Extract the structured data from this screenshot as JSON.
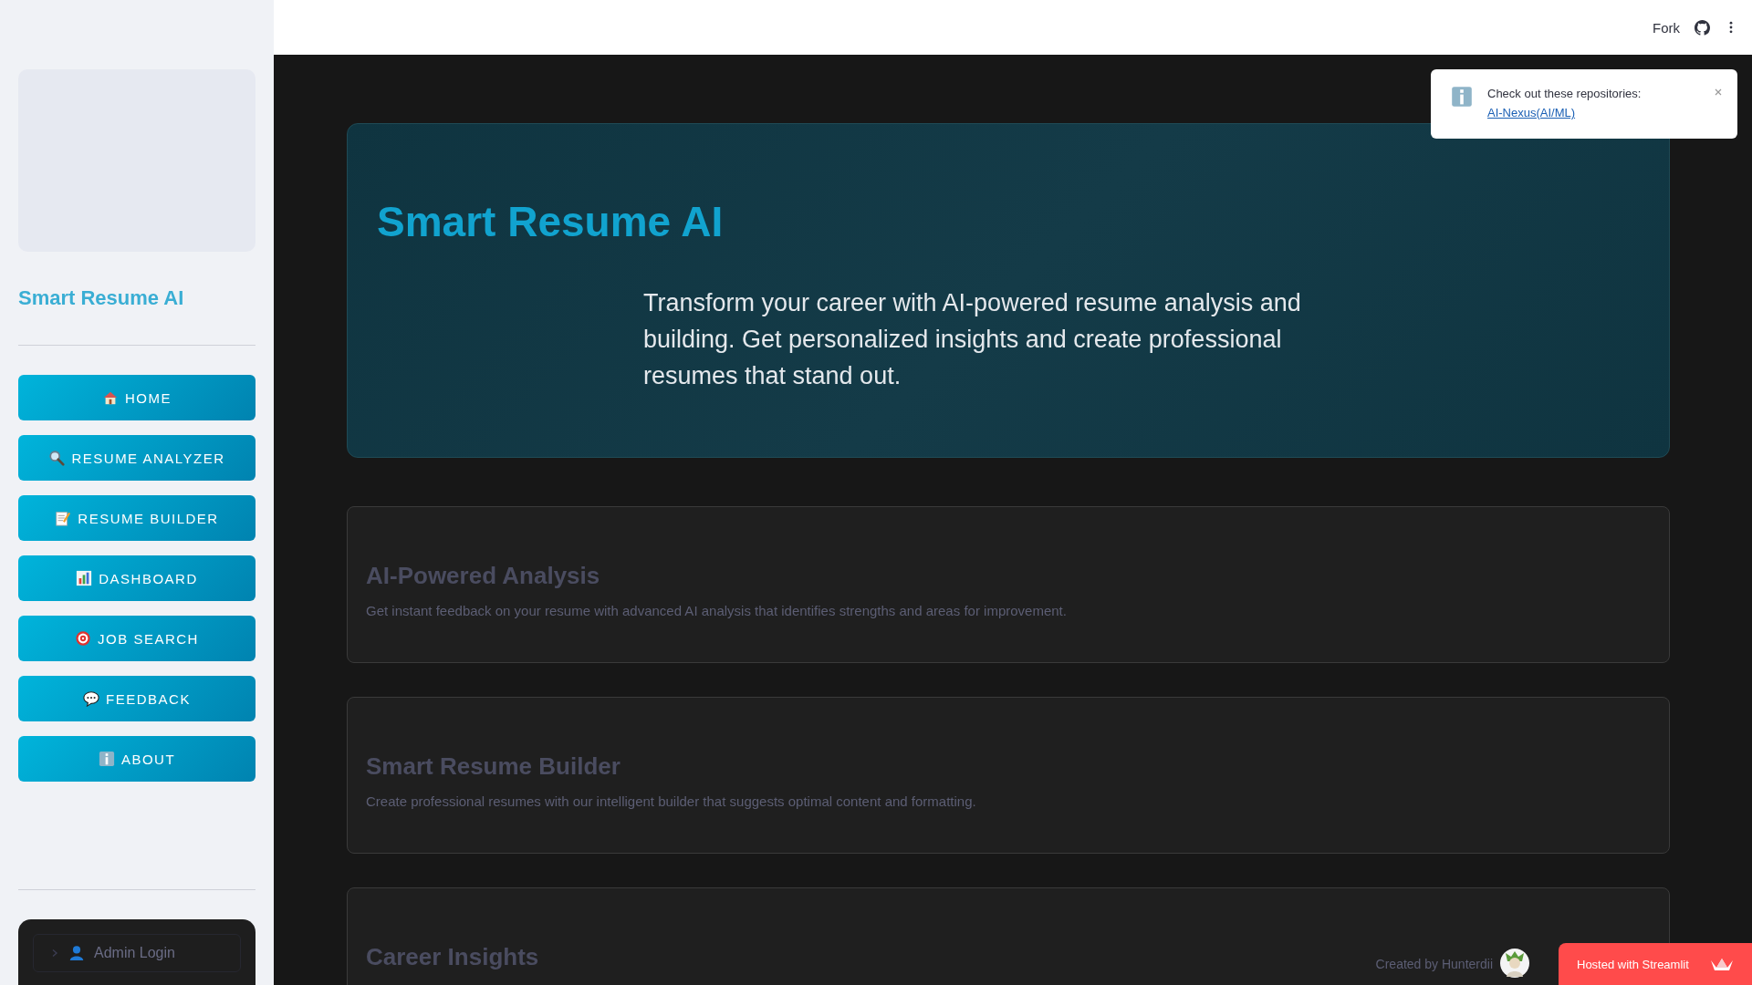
{
  "header": {
    "fork": "Fork"
  },
  "sidebar": {
    "title": "Smart Resume AI",
    "nav": [
      {
        "label": "HOME",
        "kind": "house"
      },
      {
        "label": "RESUME ANALYZER",
        "kind": "magnifier"
      },
      {
        "label": "RESUME BUILDER",
        "kind": "memo"
      },
      {
        "label": "DASHBOARD",
        "kind": "chart"
      },
      {
        "label": "JOB SEARCH",
        "kind": "target"
      },
      {
        "label": "FEEDBACK",
        "kind": "speech"
      },
      {
        "label": "ABOUT",
        "kind": "info"
      }
    ],
    "admin": {
      "label": "Admin Login",
      "expanded": false
    }
  },
  "hero": {
    "title": "Smart Resume AI",
    "text": "Transform your career with AI-powered resume analysis and building. Get personalized insights and create professional resumes that stand out."
  },
  "features": [
    {
      "title": "AI-Powered Analysis",
      "text": "Get instant feedback on your resume with advanced AI analysis that identifies strengths and areas for improvement."
    },
    {
      "title": "Smart Resume Builder",
      "text": "Create professional resumes with our intelligent builder that suggests optimal content and formatting."
    },
    {
      "title": "Career Insights"
    }
  ],
  "toast": {
    "text": "Check out these repositories:",
    "link": "AI-Nexus(AI/ML)"
  },
  "footer": {
    "credit": "Created by Hunterdii",
    "hosted": "Hosted with Streamlit"
  }
}
